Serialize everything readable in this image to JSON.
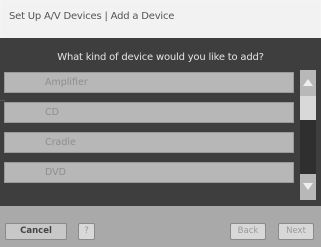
{
  "window": {
    "title": "Set Up A/V Devices | Add a Device"
  },
  "panel": {
    "question": "What kind of device would you like to add?"
  },
  "device_list": {
    "items": [
      "Amplifier",
      "CD",
      "Cradle",
      "DVD"
    ],
    "selected": null
  },
  "scrollbar": {
    "position_fraction": 0.0
  },
  "footer": {
    "cancel_label": "Cancel",
    "help_label": "?",
    "back_label": "Back",
    "next_label": "Next"
  },
  "icons": {
    "scroll_up": "up-arrow-icon",
    "scroll_down": "down-arrow-icon"
  },
  "colors": {
    "panel": "#3e3e3e",
    "list_item": "#b7b7b7",
    "footer": "#a9a9a9"
  }
}
